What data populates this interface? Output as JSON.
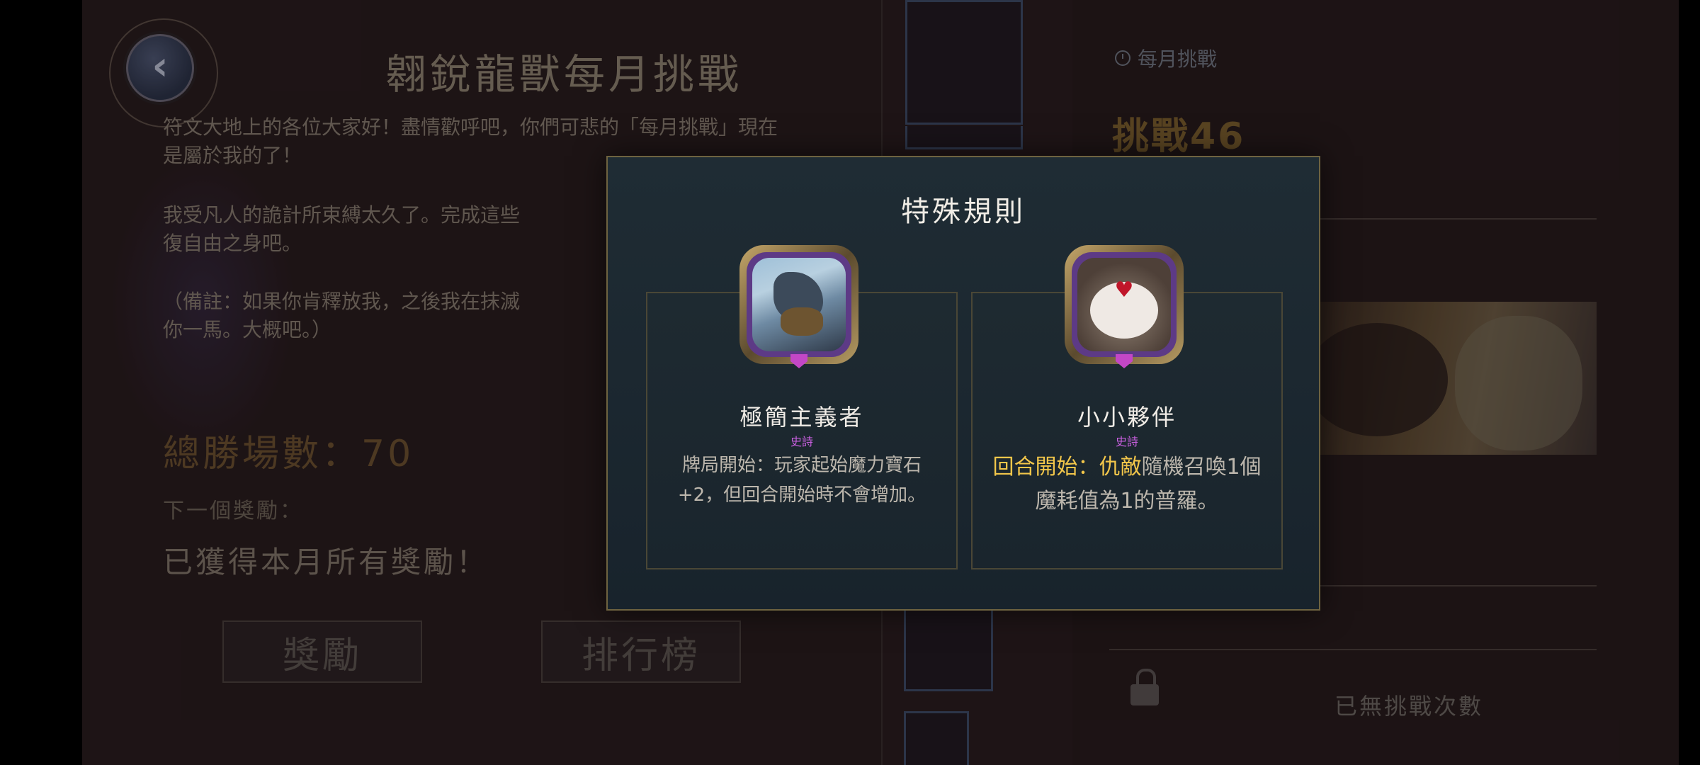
{
  "page": {
    "title": "翱銳龍獸每月挑戰",
    "back_icon": "chevron-left-icon",
    "description": [
      "符文大地上的各位大家好！盡情歡呼吧，你們可悲的「每月挑戰」現在",
      "是屬於我的了！",
      "我受凡人的詭計所束縛太久了。完成這些",
      "復自由之身吧。",
      "（備註：如果你肯釋放我，之後我在抹滅",
      "你一馬。大概吧。）"
    ],
    "total_wins": "總勝場數：70",
    "next_reward_label": "下一個獎勵：",
    "all_rewards_text": "已獲得本月所有獎勵！",
    "buttons": {
      "rewards": "獎勵",
      "leaderboard": "排行榜"
    }
  },
  "right": {
    "monthly_label": "每月挑戰",
    "challenge_title": "挑戰46",
    "star_icon": "star-icon",
    "no_attempts": "已無挑戰次數",
    "lock_icon": "lock-icon"
  },
  "modal": {
    "title": "特殊規則",
    "rules": [
      {
        "name": "極簡主義者",
        "rarity": "史詩",
        "text": "牌局開始：玩家起始魔力寶石+2，但回合開始時不會增加。"
      },
      {
        "name": "小小夥伴",
        "rarity": "史詩",
        "text_hl1": "回合開始",
        "text_sep": "：",
        "text_hl2": "仇敵",
        "text_rest": "隨機召喚1個魔耗值為1的普羅。"
      }
    ]
  },
  "colors": {
    "highlight": "#f2c64a",
    "rarity_epic": "#c95fe0",
    "modal_border": "#6e6340"
  }
}
